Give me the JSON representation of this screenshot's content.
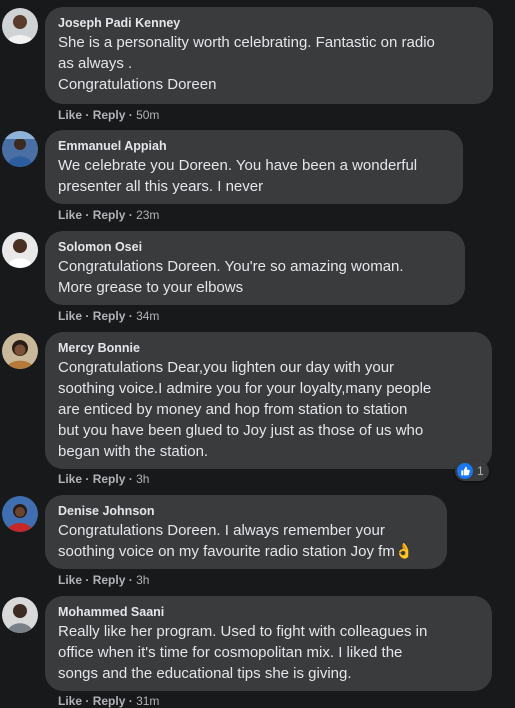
{
  "comments": [
    {
      "author": "Joseph Padi Kenney",
      "text": "She is a personality worth celebrating. Fantastic on radio\nas always .\nCongratulations Doreen",
      "like": "Like",
      "reply": "Reply",
      "time": "50m"
    },
    {
      "author": "Emmanuel Appiah",
      "text": "We celebrate you Doreen. You have been a wonderful\npresenter all this years. I never",
      "like": "Like",
      "reply": "Reply",
      "time": "23m"
    },
    {
      "author": "Solomon Osei",
      "text": "Congratulations Doreen. You're so amazing woman.\nMore grease to your elbows",
      "like": "Like",
      "reply": "Reply",
      "time": "34m"
    },
    {
      "author": "Mercy Bonnie",
      "text": "Congratulations Dear,you lighten our day with your\nsoothing voice.I admire you for your loyalty,many people\nare enticed by money and hop from station to station\nbut you have been glued to Joy just as those of us who\nbegan with the station.",
      "like": "Like",
      "reply": "Reply",
      "time": "3h",
      "reaction_count": "1"
    },
    {
      "author": "Denise Johnson",
      "text": "Congratulations Doreen. I always remember your\nsoothing voice on my favourite radio station Joy fm👌",
      "like": "Like",
      "reply": "Reply",
      "time": "3h"
    },
    {
      "author": "Mohammed Saani",
      "text": "Really like her program. Used to fight with colleagues in\noffice when it's time for cosmopolitan mix. I liked the\nsongs and the educational tips she is giving.",
      "like": "Like",
      "reply": "Reply",
      "time": "31m"
    }
  ],
  "separator": "·",
  "colors": {
    "background": "#18191a",
    "bubble": "#3a3b3c",
    "text": "#e4e6eb",
    "secondary": "#b0b3b8",
    "like_blue": "#1877f2"
  }
}
